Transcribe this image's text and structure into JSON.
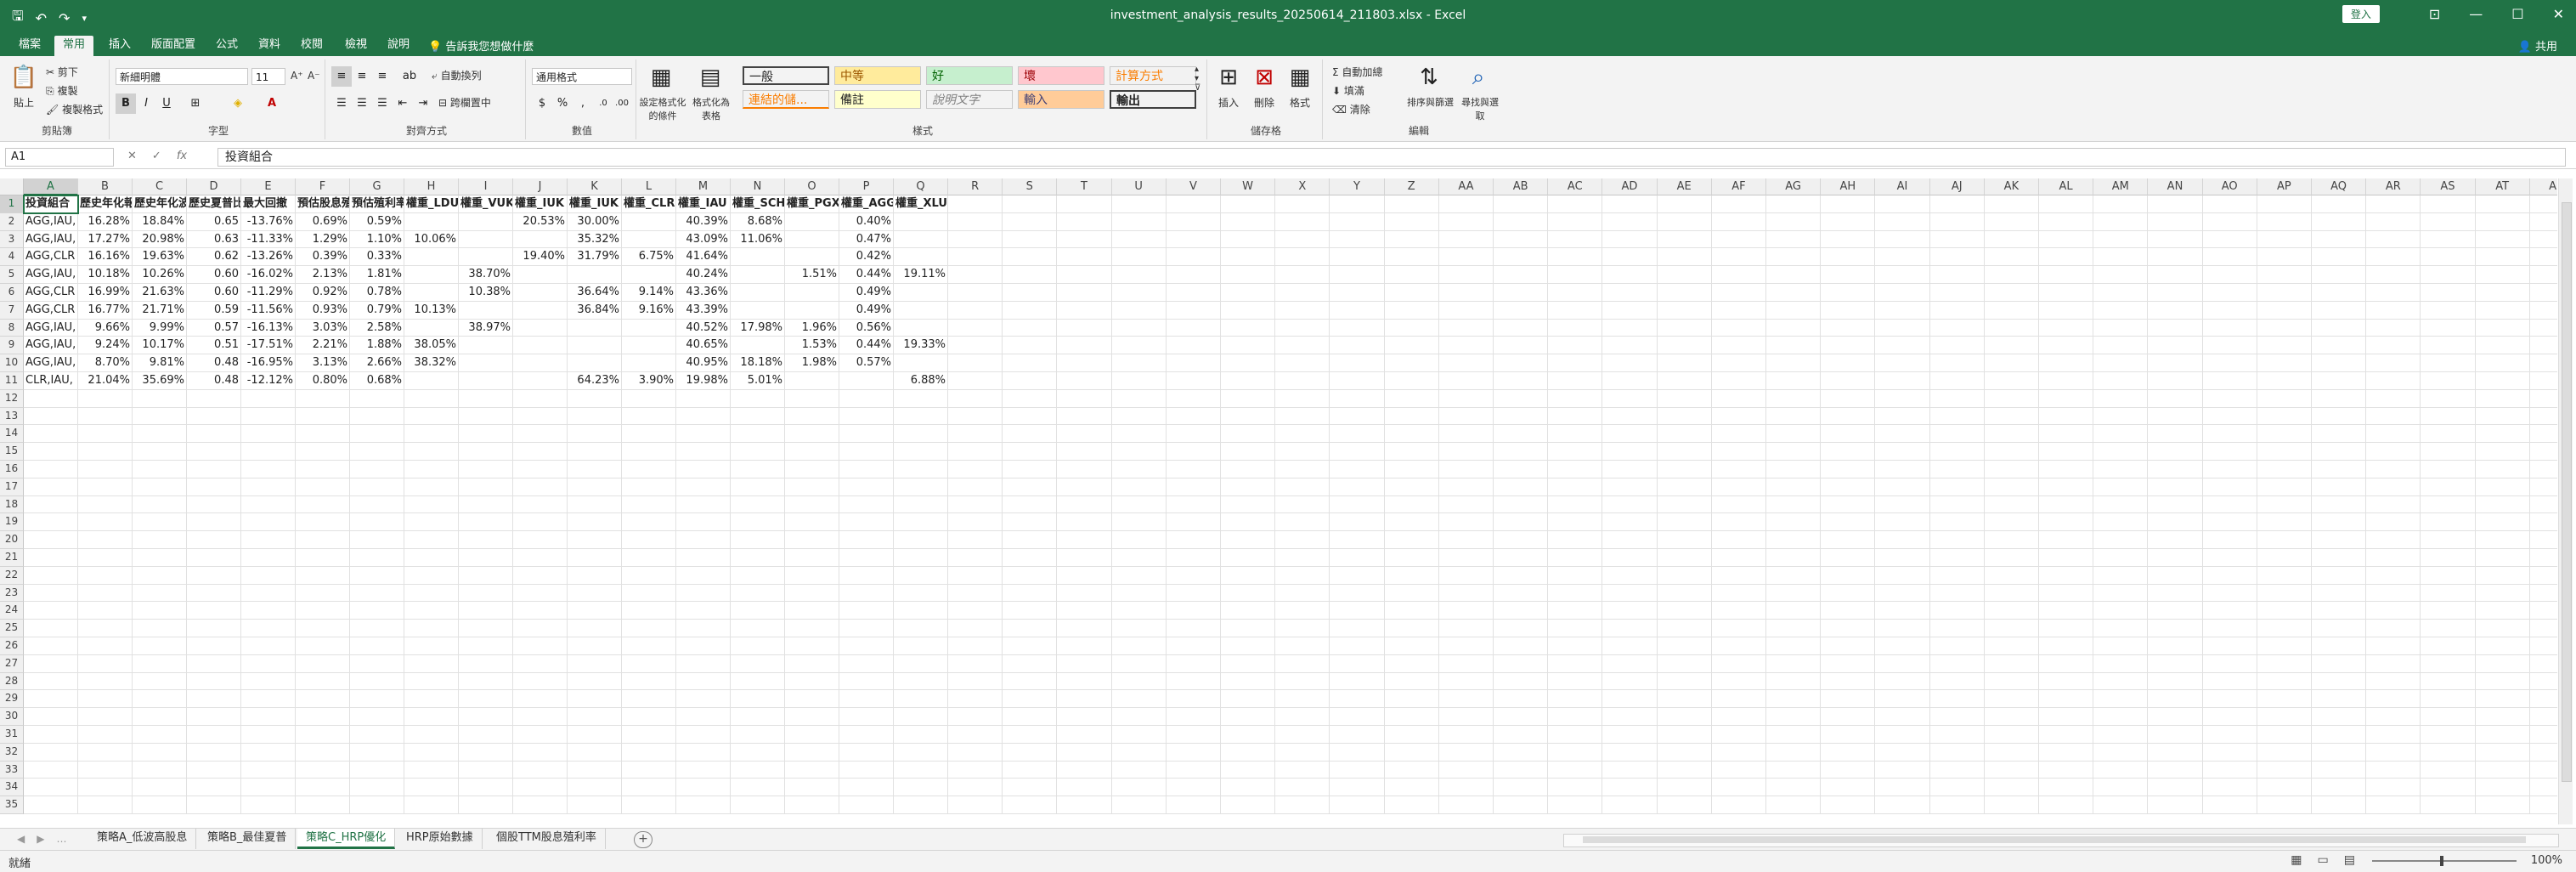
{
  "window": {
    "title": "investment_analysis_results_20250614_211803.xlsx - Excel",
    "login_label": "登入",
    "share_label": "共用",
    "minimize_icon": "—",
    "restore_icon": "☐",
    "close_icon": "✕"
  },
  "ribbon_tabs": [
    {
      "label": "檔案"
    },
    {
      "label": "常用"
    },
    {
      "label": "插入"
    },
    {
      "label": "版面配置"
    },
    {
      "label": "公式"
    },
    {
      "label": "資料"
    },
    {
      "label": "校閱"
    },
    {
      "label": "檢視"
    },
    {
      "label": "說明"
    }
  ],
  "tell_me": "告訴我您想做什麼",
  "ribbon": {
    "clipboard": {
      "label": "剪貼簿",
      "paste": "貼上",
      "cut": "剪下",
      "copy": "複製",
      "format_painter": "複製格式"
    },
    "font": {
      "label": "字型",
      "name": "新細明體",
      "size": "11",
      "bold": "B",
      "italic": "I",
      "underline": "U"
    },
    "alignment": {
      "label": "對齊方式",
      "wrap": "自動換列",
      "merge": "跨欄置中"
    },
    "number": {
      "label": "數值",
      "format": "通用格式",
      "currency": "$",
      "percent": "%",
      "comma": ","
    },
    "cond_format": "設定格式化的條件",
    "format_table": "格式化為表格",
    "styles": {
      "label": "樣式",
      "items": [
        {
          "name": "一般",
          "bg": "#ffffff",
          "fg": "#000000"
        },
        {
          "name": "中等",
          "bg": "#ffeb9c",
          "fg": "#9c5700"
        },
        {
          "name": "好",
          "bg": "#c6efce",
          "fg": "#006100"
        },
        {
          "name": "壞",
          "bg": "#ffc7ce",
          "fg": "#9c0006"
        },
        {
          "name": "計算方式",
          "bg": "#f2f2f2",
          "fg": "#fa7d00"
        },
        {
          "name": "連結的儲...",
          "bg": "#ffffff",
          "fg": "#fa7d00"
        },
        {
          "name": "備註",
          "bg": "#ffffcc",
          "fg": "#000000"
        },
        {
          "name": "說明文字",
          "bg": "#ffffff",
          "fg": "#7f7f7f"
        },
        {
          "name": "輸入",
          "bg": "#ffcc99",
          "fg": "#3f3f76"
        },
        {
          "name": "輸出",
          "bg": "#f2f2f2",
          "fg": "#3f3f3f"
        }
      ]
    },
    "cells": {
      "label": "儲存格",
      "insert": "插入",
      "delete": "刪除",
      "format": "格式"
    },
    "editing": {
      "label": "編輯",
      "autosum": "自動加總",
      "fill": "填滿",
      "clear": "清除",
      "sort": "排序與篩選",
      "find": "尋找與選取"
    }
  },
  "formula_bar": {
    "name_box": "A1",
    "cancel": "✕",
    "enter": "✓",
    "fx": "fx",
    "content": "投資組合"
  },
  "columns": [
    "A",
    "B",
    "C",
    "D",
    "E",
    "F",
    "G",
    "H",
    "I",
    "J",
    "K",
    "L",
    "M",
    "N",
    "O",
    "P",
    "Q",
    "R",
    "S",
    "T",
    "U",
    "V",
    "W",
    "X",
    "Y",
    "Z",
    "AA",
    "AB",
    "AC",
    "AD",
    "AE",
    "AF",
    "AG",
    "AH",
    "AI",
    "AJ",
    "AK",
    "AL",
    "AM",
    "AN",
    "AO",
    "AP",
    "AQ",
    "AR",
    "AS",
    "AT",
    "AU"
  ],
  "row_count": 35,
  "table": {
    "headers": [
      "投資組合",
      "歷史年化報酬",
      "歷史年化波動",
      "歷史夏普比率",
      "最大回撤",
      "預估股息殖利率",
      "預估殖利率TTM",
      "權重_LDU",
      "權重_VUK",
      "權重_IUK",
      "權重_IUK",
      "權重_CLR",
      "權重_IAU",
      "權重_SCH",
      "權重_PGX",
      "權重_AGG",
      "權重_XLU"
    ],
    "rows": [
      [
        "AGG,IAU,",
        "16.28%",
        "18.84%",
        "0.65",
        "-13.76%",
        "0.69%",
        "0.59%",
        "",
        "",
        "20.53%",
        "30.00%",
        "",
        "40.39%",
        "8.68%",
        "",
        "0.40%",
        ""
      ],
      [
        "AGG,IAU,",
        "17.27%",
        "20.98%",
        "0.63",
        "-11.33%",
        "1.29%",
        "1.10%",
        "10.06%",
        "",
        "",
        "35.32%",
        "",
        "43.09%",
        "11.06%",
        "",
        "0.47%",
        ""
      ],
      [
        "AGG,CLR",
        "16.16%",
        "19.63%",
        "0.62",
        "-13.26%",
        "0.39%",
        "0.33%",
        "",
        "",
        "19.40%",
        "31.79%",
        "6.75%",
        "41.64%",
        "",
        "",
        "0.42%",
        ""
      ],
      [
        "AGG,IAU,",
        "10.18%",
        "10.26%",
        "0.60",
        "-16.02%",
        "2.13%",
        "1.81%",
        "",
        "38.70%",
        "",
        "",
        "",
        "40.24%",
        "",
        "1.51%",
        "0.44%",
        "19.11%"
      ],
      [
        "AGG,CLR",
        "16.99%",
        "21.63%",
        "0.60",
        "-11.29%",
        "0.92%",
        "0.78%",
        "",
        "10.38%",
        "",
        "36.64%",
        "9.14%",
        "43.36%",
        "",
        "",
        "0.49%",
        ""
      ],
      [
        "AGG,CLR",
        "16.77%",
        "21.71%",
        "0.59",
        "-11.56%",
        "0.93%",
        "0.79%",
        "10.13%",
        "",
        "",
        "36.84%",
        "9.16%",
        "43.39%",
        "",
        "",
        "0.49%",
        ""
      ],
      [
        "AGG,IAU,",
        "9.66%",
        "9.99%",
        "0.57",
        "-16.13%",
        "3.03%",
        "2.58%",
        "",
        "38.97%",
        "",
        "",
        "",
        "40.52%",
        "17.98%",
        "1.96%",
        "0.56%",
        ""
      ],
      [
        "AGG,IAU,",
        "9.24%",
        "10.17%",
        "0.51",
        "-17.51%",
        "2.21%",
        "1.88%",
        "38.05%",
        "",
        "",
        "",
        "",
        "40.65%",
        "",
        "1.53%",
        "0.44%",
        "19.33%"
      ],
      [
        "AGG,IAU,",
        "8.70%",
        "9.81%",
        "0.48",
        "-16.95%",
        "3.13%",
        "2.66%",
        "38.32%",
        "",
        "",
        "",
        "",
        "40.95%",
        "18.18%",
        "1.98%",
        "0.57%",
        ""
      ],
      [
        "CLR,IAU,",
        "21.04%",
        "35.69%",
        "0.48",
        "-12.12%",
        "0.80%",
        "0.68%",
        "",
        "",
        "",
        "64.23%",
        "3.90%",
        "19.98%",
        "5.01%",
        "",
        "",
        "6.88%"
      ]
    ]
  },
  "sheet_tabs": [
    {
      "label": "策略A_低波高股息",
      "active": false
    },
    {
      "label": "策略B_最佳夏普",
      "active": false
    },
    {
      "label": "策略C_HRP優化",
      "active": true
    },
    {
      "label": "HRP原始數據",
      "active": false
    },
    {
      "label": "個股TTM股息殖利率",
      "active": false
    }
  ],
  "status": {
    "ready": "就緒",
    "zoom": "100%"
  }
}
